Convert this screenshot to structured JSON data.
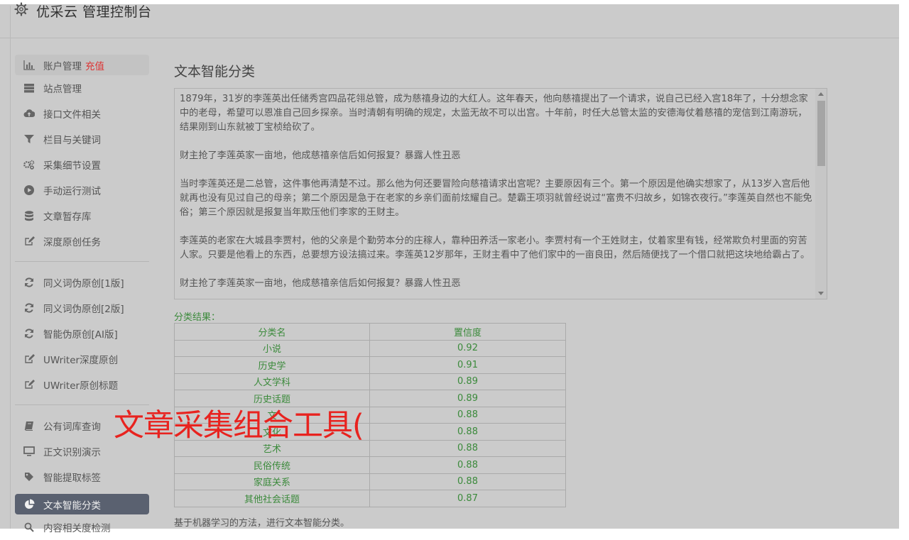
{
  "header": {
    "title": "优采云 管理控制台"
  },
  "sidebar": {
    "group1": [
      {
        "label": "账户管理",
        "extra": "充值",
        "icon": "bar-chart-icon"
      },
      {
        "label": "站点管理",
        "icon": "server-icon"
      },
      {
        "label": "接口文件相关",
        "icon": "cloud-upload-icon"
      },
      {
        "label": "栏目与关键词",
        "icon": "filter-icon"
      },
      {
        "label": "采集细节设置",
        "icon": "gears-icon"
      },
      {
        "label": "手动运行测试",
        "icon": "play-circle-icon"
      },
      {
        "label": "文章暂存库",
        "icon": "database-icon"
      },
      {
        "label": "深度原创任务",
        "icon": "edit-icon"
      }
    ],
    "group2": [
      {
        "label": "同义词伪原创[1版]",
        "icon": "refresh-icon"
      },
      {
        "label": "同义词伪原创[2版]",
        "icon": "refresh-icon"
      },
      {
        "label": "智能伪原创[AI版]",
        "icon": "refresh-icon"
      },
      {
        "label": "UWriter深度原创",
        "icon": "edit-icon"
      },
      {
        "label": "UWriter原创标题",
        "icon": "edit-icon"
      }
    ],
    "group3": [
      {
        "label": "公有词库查询",
        "icon": "book-icon"
      },
      {
        "label": "正文识别演示",
        "icon": "monitor-icon"
      },
      {
        "label": "智能提取标签",
        "icon": "tag-icon"
      },
      {
        "label": "文本智能分类",
        "icon": "pie-chart-icon"
      },
      {
        "label": "内容相关度检测",
        "icon": "search-icon"
      }
    ]
  },
  "main": {
    "title": "文本智能分类",
    "input_text": "1879年，31岁的李莲英出任储秀宫四品花翎总管，成为慈禧身边的大红人。这年春天，他向慈禧提出了一个请求，说自己已经入宫18年了，十分想念家中的老母，希望可以恩准自己回乡探亲。当时清朝有明确的规定，太监无故不可以出宫。十年前，时任大总管太监的安德海仗着慈禧的宠信到江南游玩，结果刚到山东就被丁宝桢给砍了。\n\n财主抢了李莲英家一亩地，他成慈禧亲信后如何报复？暴露人性丑恶\n\n当时李莲英还是二总管，这件事他再清楚不过。那么他为何还要冒险向慈禧请求出宫呢？主要原因有三个。第一个原因是他确实想家了，从13岁入宫后他就再也没有见过自己的母亲；第二个原因是急于在老家的乡亲们面前炫耀自己。楚霸王项羽就曾经说过“富贵不归故乡，如锦衣夜行。”李莲英自然也不能免俗；第三个原因就是报复当年欺压他们李家的王财主。\n\n李莲英的老家在大城县李贾村，他的父亲是个勤劳本分的庄稼人，靠种田养活一家老小。李贾村有一个王姓财主，仗着家里有钱，经常欺负村里面的穷苦人家。只要是他看上的东西，总要想方设法搞过来。李莲英12岁那年，王财主看中了他们家中的一亩良田，然后随便找了一个借口就把这块地给霸占了。\n\n财主抢了李莲英家一亩地，他成慈禧亲信后如何报复？暴露人性丑恶",
    "result_label": "分类结果：",
    "table_headers": [
      "分类名",
      "置信度"
    ],
    "rows": [
      [
        "小说",
        "0.92"
      ],
      [
        "历史学",
        "0.91"
      ],
      [
        "人文学科",
        "0.89"
      ],
      [
        "历史话题",
        "0.89"
      ],
      [
        "文",
        "0.88"
      ],
      [
        "文化",
        "0.88"
      ],
      [
        "艺术",
        "0.88"
      ],
      [
        "民俗传统",
        "0.88"
      ],
      [
        "家庭关系",
        "0.88"
      ],
      [
        "其他社会话题",
        "0.87"
      ]
    ],
    "footer_note": "基于机器学习的方法，进行文本智能分类。"
  },
  "overlay": {
    "text": "文章采集组合工具("
  },
  "colors": {
    "active_nav": "#5a6170",
    "result_green": "#3b8a3b",
    "overlay_red": "#e8231f"
  }
}
